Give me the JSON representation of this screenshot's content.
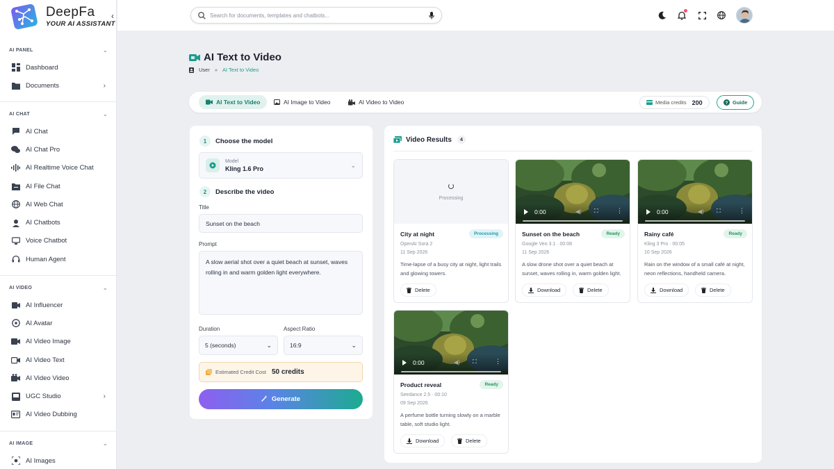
{
  "brand": {
    "name": "DeepFa",
    "tagline": "YOUR AI ASSISTANT"
  },
  "sidebar": {
    "sections": [
      {
        "title": "AI PANEL",
        "items": [
          {
            "label": "Dashboard",
            "icon": "dashboard-icon"
          },
          {
            "label": "Documents",
            "icon": "folder-icon",
            "has_submenu": true
          }
        ]
      },
      {
        "title": "AI CHAT",
        "items": [
          {
            "label": "AI Chat",
            "icon": "chat-icon"
          },
          {
            "label": "AI Chat Pro",
            "icon": "chats-icon"
          },
          {
            "label": "AI Realtime Voice Chat",
            "icon": "waveform-icon"
          },
          {
            "label": "AI File Chat",
            "icon": "file-chat-icon"
          },
          {
            "label": "AI Web Chat",
            "icon": "globe-icon"
          },
          {
            "label": "AI Chatbots",
            "icon": "robot-icon"
          },
          {
            "label": "Voice Chatbot",
            "icon": "voice-chat-icon"
          },
          {
            "label": "Human Agent",
            "icon": "headset-icon"
          }
        ]
      },
      {
        "title": "AI VIDEO",
        "items": [
          {
            "label": "AI Influencer",
            "icon": "influencer-icon"
          },
          {
            "label": "AI Avatar",
            "icon": "avatar-icon"
          },
          {
            "label": "AI Video Image",
            "icon": "video-icon"
          },
          {
            "label": "AI Video Text",
            "icon": "video-text-icon"
          },
          {
            "label": "AI Video Video",
            "icon": "video-video-icon"
          },
          {
            "label": "UGC Studio",
            "icon": "studio-icon",
            "has_submenu": true
          },
          {
            "label": "AI Video Dubbing",
            "icon": "dubbing-icon"
          }
        ]
      },
      {
        "title": "AI IMAGE",
        "items": [
          {
            "label": "AI Images",
            "icon": "image-scan-icon"
          }
        ]
      }
    ]
  },
  "topbar": {
    "search_placeholder": "Search for documents, templates and chatbots...",
    "icons": [
      "moon-icon",
      "bell-icon",
      "fullscreen-icon",
      "globe-icon",
      "user-avatar"
    ]
  },
  "page": {
    "title": "AI Text to Video",
    "breadcrumb": [
      "User",
      "AI Text to Video"
    ],
    "breadcrumb_sep": "»"
  },
  "tabs": [
    {
      "label": "AI Text to Video",
      "active": true
    },
    {
      "label": "AI Image to Video",
      "active": false
    },
    {
      "label": "AI Video to Video",
      "active": false
    }
  ],
  "credits": {
    "label": "Media credits",
    "value": "200"
  },
  "guide_label": "Guide",
  "form": {
    "step1": {
      "num": "1",
      "title": "Choose the model"
    },
    "model": {
      "label": "Model",
      "value": "Kling 1.6 Pro"
    },
    "step2": {
      "num": "2",
      "title": "Describe the video"
    },
    "title_label": "Title",
    "title_value": "Sunset on the beach",
    "prompt_label": "Prompt",
    "prompt_value": "A slow aerial shot over a quiet beach at sunset, waves rolling in and warm golden light everywhere.",
    "duration_label": "Duration",
    "duration_value": "5 (seconds)",
    "aspect_label": "Aspect Ratio",
    "aspect_value": "16:9",
    "cost_label": "Estimated Credit Cost",
    "cost_value": "50 credits",
    "generate_label": "Generate"
  },
  "results": {
    "title": "Video Results",
    "count": "4",
    "download_label": "Download",
    "delete_label": "Delete",
    "processing_text": "Processing",
    "video_time": "0:00",
    "items": [
      {
        "title": "City at night",
        "status": "Processing",
        "model": "OpenAI Sora 2",
        "date": "11 Sep 2026",
        "desc": "Time-lapse of a busy city at night, light trails and glowing towers."
      },
      {
        "title": "Sunset on the beach",
        "status": "Ready",
        "model": "Google Veo 3.1 · 00:08",
        "date": "11 Sep 2026",
        "desc": "A slow drone shot over a quiet beach at sunset, waves rolling in, warm golden light."
      },
      {
        "title": "Rainy café",
        "status": "Ready",
        "model": "Kling 3 Pro · 00:05",
        "date": "10 Sep 2026",
        "desc": "Rain on the window of a small café at night, neon reflections, handheld camera."
      },
      {
        "title": "Product reveal",
        "status": "Ready",
        "model": "Seedance 2.5 · 00:10",
        "date": "09 Sep 2026",
        "desc": "A perfume bottle turning slowly on a marble table, soft studio light."
      }
    ]
  },
  "colors": {
    "accent": "#1e9c8c",
    "ready": "#21955b",
    "processing": "#1e9aaa",
    "gradient_start": "#8e5ff0",
    "gradient_end": "#1dab90"
  }
}
